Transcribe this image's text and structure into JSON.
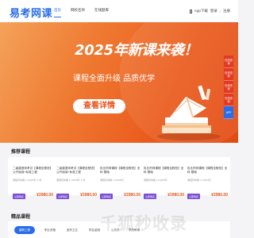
{
  "header": {
    "logo": "易考网课",
    "nav": [
      {
        "label": "首页",
        "active": true
      },
      {
        "label": "网校名师",
        "active": false
      },
      {
        "label": "在线题库",
        "active": false
      }
    ],
    "app_download": "App下载",
    "login": "登录",
    "register": "注册"
  },
  "banner": {
    "title": "2025年新课来袭！",
    "subtitle": "课程全面升级 品质优学",
    "button": "查看详情"
  },
  "sidebar": {
    "items": [
      "在线咨询",
      "在线咨询",
      "在线咨询",
      "在线咨询",
      "APP"
    ]
  },
  "featured": {
    "title": "推荐课程",
    "cards": [
      {
        "title": "二级建造师考试【课程全程班】公开阅读+标准工程",
        "meta": "课程有效期 1 (2025年) 1 科",
        "tag": "立即购买",
        "price": "¥3980.00"
      },
      {
        "title": "二级建造师考试【课程全程班】公开阅读+标准工程",
        "meta": "课程有效期 1 (2025年) 1 科",
        "tag": "立即购买",
        "price": "¥3980.00"
      },
      {
        "title": "执业药师课程【课程全程班】全科·基础",
        "meta": "课程有效期 1 (2025年)",
        "tag": "立即购买",
        "price": "¥3980.00"
      },
      {
        "title": "执业药师课程【课程全程班】全科·基础",
        "meta": "课程有效期 1 (2025年)",
        "tag": "立即购买",
        "price": "¥3980.00"
      },
      {
        "title": "执业药师课程【课程全程班】全科·基础",
        "meta": "课程有效期 1 (2025年)",
        "tag": "立即购买",
        "price": "¥3980.00"
      }
    ]
  },
  "quality": {
    "title": "精品课程",
    "tabs": [
      {
        "label": "建筑工程",
        "active": true
      },
      {
        "label": "职业资格",
        "active": false
      },
      {
        "label": "医药卫生",
        "active": false
      },
      {
        "label": "财会金融",
        "active": false
      },
      {
        "label": "公务员",
        "active": false
      },
      {
        "label": "学历教育",
        "active": false
      }
    ]
  },
  "watermark": "千狐秒收录"
}
